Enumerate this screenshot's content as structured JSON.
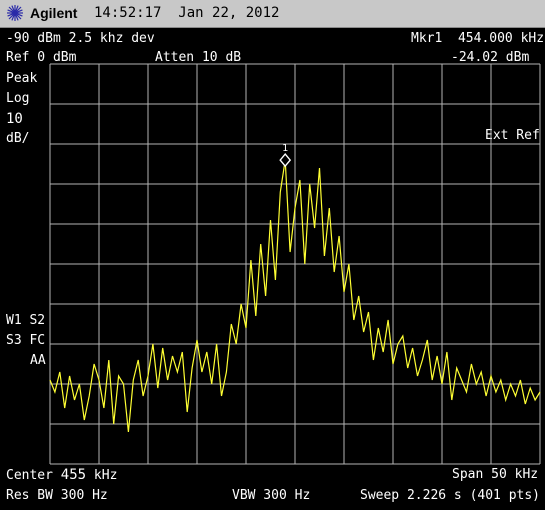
{
  "instrument": {
    "brand": "Agilent",
    "time": "14:52:17",
    "date": "Jan 22, 2012"
  },
  "header": {
    "line1_left": "-90 dBm 2.5 khz dev",
    "marker_label": "Mkr1",
    "marker_freq": "454.000 kHz",
    "ref": "Ref 0 dBm",
    "atten": "Atten 10 dB",
    "marker_level": "-24.02 dBm"
  },
  "side_left": {
    "detector": "Peak",
    "scale_type": "Log",
    "scale_value": "10",
    "scale_unit": "dB/",
    "trace_flags_1": "W1 S2",
    "trace_flags_2": "S3 FC",
    "trace_flags_3": "AA"
  },
  "side_right": {
    "trigger": "Ext Ref"
  },
  "marker": {
    "number": "1"
  },
  "footer": {
    "center_label": "Center",
    "center_value": "455",
    "center_unit": "kHz",
    "span": "Span 50 kHz",
    "rbw": "Res BW 300 Hz",
    "vbw": "VBW 300 Hz",
    "sweep": "Sweep 2.226 s (401 pts)"
  },
  "colors": {
    "trace": "#ffff33",
    "grid": "#b4b4b4",
    "background": "#000000",
    "status_bar": "#c8c8c8"
  },
  "chart_data": {
    "type": "line",
    "x_unit": "kHz",
    "y_unit": "dBm",
    "xlim": [
      430,
      480
    ],
    "ylim": [
      -100,
      0
    ],
    "grid": true,
    "series": [
      {
        "values": [
          [
            430.0,
            -79
          ],
          [
            430.5,
            -82
          ],
          [
            431.0,
            -77
          ],
          [
            431.5,
            -86
          ],
          [
            432.0,
            -78
          ],
          [
            432.5,
            -84
          ],
          [
            433.0,
            -80
          ],
          [
            433.5,
            -89
          ],
          [
            434.0,
            -83
          ],
          [
            434.5,
            -75
          ],
          [
            435.0,
            -79
          ],
          [
            435.5,
            -86
          ],
          [
            436.0,
            -74
          ],
          [
            436.5,
            -90
          ],
          [
            437.0,
            -78
          ],
          [
            437.5,
            -80
          ],
          [
            438.0,
            -92
          ],
          [
            438.5,
            -79
          ],
          [
            439.0,
            -74
          ],
          [
            439.5,
            -83
          ],
          [
            440.0,
            -78
          ],
          [
            440.5,
            -70
          ],
          [
            441.0,
            -81
          ],
          [
            441.5,
            -71
          ],
          [
            442.0,
            -79
          ],
          [
            442.5,
            -73
          ],
          [
            443.0,
            -77
          ],
          [
            443.5,
            -72
          ],
          [
            444.0,
            -87
          ],
          [
            444.5,
            -76
          ],
          [
            445.0,
            -69
          ],
          [
            445.5,
            -77
          ],
          [
            446.0,
            -72
          ],
          [
            446.5,
            -80
          ],
          [
            447.0,
            -70
          ],
          [
            447.5,
            -83
          ],
          [
            448.0,
            -77
          ],
          [
            448.5,
            -65
          ],
          [
            449.0,
            -70
          ],
          [
            449.5,
            -60
          ],
          [
            450.0,
            -66
          ],
          [
            450.5,
            -49
          ],
          [
            451.0,
            -63
          ],
          [
            451.5,
            -45
          ],
          [
            452.0,
            -58
          ],
          [
            452.5,
            -39
          ],
          [
            453.0,
            -54
          ],
          [
            453.5,
            -32
          ],
          [
            454.0,
            -24
          ],
          [
            454.5,
            -47
          ],
          [
            455.0,
            -36
          ],
          [
            455.5,
            -29
          ],
          [
            456.0,
            -50
          ],
          [
            456.5,
            -30
          ],
          [
            457.0,
            -41
          ],
          [
            457.5,
            -26
          ],
          [
            458.0,
            -48
          ],
          [
            458.5,
            -36
          ],
          [
            459.0,
            -52
          ],
          [
            459.5,
            -43
          ],
          [
            460.0,
            -57
          ],
          [
            460.5,
            -50
          ],
          [
            461.0,
            -64
          ],
          [
            461.5,
            -58
          ],
          [
            462.0,
            -67
          ],
          [
            462.5,
            -62
          ],
          [
            463.0,
            -74
          ],
          [
            463.5,
            -66
          ],
          [
            464.0,
            -72
          ],
          [
            464.5,
            -64
          ],
          [
            465.0,
            -75
          ],
          [
            465.5,
            -70
          ],
          [
            466.0,
            -68
          ],
          [
            466.5,
            -76
          ],
          [
            467.0,
            -71
          ],
          [
            467.5,
            -78
          ],
          [
            468.0,
            -74
          ],
          [
            468.5,
            -69
          ],
          [
            469.0,
            -79
          ],
          [
            469.5,
            -73
          ],
          [
            470.0,
            -80
          ],
          [
            470.5,
            -72
          ],
          [
            471.0,
            -84
          ],
          [
            471.5,
            -76
          ],
          [
            472.0,
            -79
          ],
          [
            472.5,
            -82
          ],
          [
            473.0,
            -75
          ],
          [
            473.5,
            -80
          ],
          [
            474.0,
            -77
          ],
          [
            474.5,
            -83
          ],
          [
            475.0,
            -78
          ],
          [
            475.5,
            -82
          ],
          [
            476.0,
            -79
          ],
          [
            476.5,
            -84
          ],
          [
            477.0,
            -80
          ],
          [
            477.5,
            -83
          ],
          [
            478.0,
            -79
          ],
          [
            478.5,
            -85
          ],
          [
            479.0,
            -81
          ],
          [
            479.5,
            -84
          ],
          [
            480.0,
            -82
          ]
        ]
      }
    ],
    "marker": {
      "x": 454.0,
      "y": -24.02
    }
  }
}
